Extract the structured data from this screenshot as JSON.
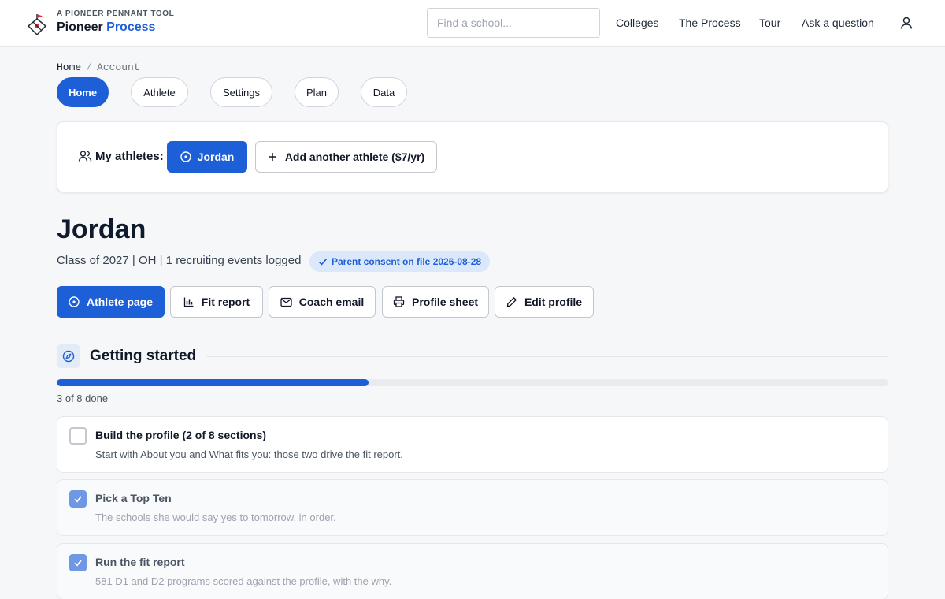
{
  "brand": {
    "kicker": "A PIONEER PENNANT TOOL",
    "name_primary": "Pioneer",
    "name_accent": "Process",
    "accent_color": "#1d5fd6"
  },
  "search": {
    "placeholder": "Find a school...",
    "value": ""
  },
  "nav": {
    "colleges": "Colleges",
    "process": "The Process",
    "tour": "Tour",
    "ask": "Ask a question",
    "user_icon": "user-icon"
  },
  "breadcrumb": {
    "home": "Home",
    "separator": "/",
    "current": "Account"
  },
  "tabs": {
    "home": "Home",
    "athlete": "Athlete",
    "settings": "Settings",
    "plan": "Plan",
    "data": "Data",
    "active": "Home"
  },
  "athletes_panel": {
    "label": "My athletes:",
    "selected": "Jordan",
    "add_label": "Add another athlete ($7/yr)"
  },
  "athlete": {
    "name": "Jordan",
    "meta": "Class of 2027 | OH | 1 recruiting events logged",
    "consent": "Parent consent on file 2026-08-28"
  },
  "actions": {
    "athlete_page": "Athlete page",
    "fit_report": "Fit report",
    "coach_email": "Coach email",
    "profile_sheet": "Profile sheet",
    "edit_profile": "Edit profile"
  },
  "getting_started": {
    "title": "Getting started",
    "progress_text": "3 of 8 done",
    "completed": 3,
    "total": 8,
    "tasks": [
      {
        "title": "Build the profile (2 of 8 sections)",
        "description": "Start with About you and What fits you: those two drive the fit report.",
        "done": false
      },
      {
        "title": "Pick a Top Ten",
        "description": "The schools she would say yes to tomorrow, in order.",
        "done": true
      },
      {
        "title": "Run the fit report",
        "description": "581 D1 and D2 programs scored against the profile, with the why.",
        "done": true
      }
    ]
  }
}
